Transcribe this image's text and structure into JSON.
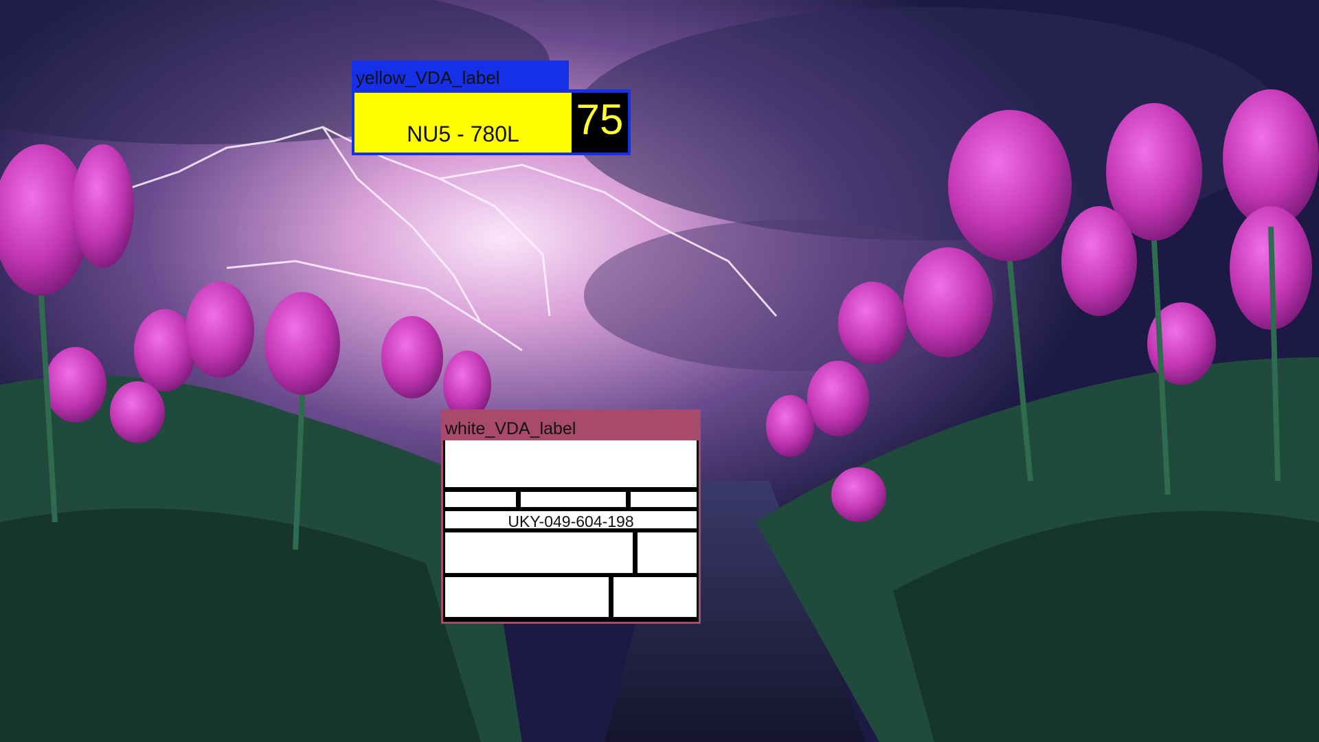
{
  "yellow_label": {
    "title": "yellow_VDA_label",
    "plate_number": "NU5 - 780L",
    "score": "75",
    "colors": {
      "frame": "#1530e6",
      "plate": "#ffff00",
      "score_text": "#ffff33",
      "score_bg": "#000000"
    }
  },
  "white_label": {
    "title": "white_VDA_label",
    "serial_number": "UKY-049-604-198",
    "colors": {
      "frame": "#a84a6c",
      "cells": "#ffffff",
      "grid_lines": "#000000"
    }
  },
  "background": {
    "description_icon": "tulip-field-lightning-storm-image",
    "colors": {
      "sky": "#2a2458",
      "lightning_glow": "#f3d4f2",
      "tulips": "#d040c0",
      "foliage": "#1f4a3c"
    }
  }
}
